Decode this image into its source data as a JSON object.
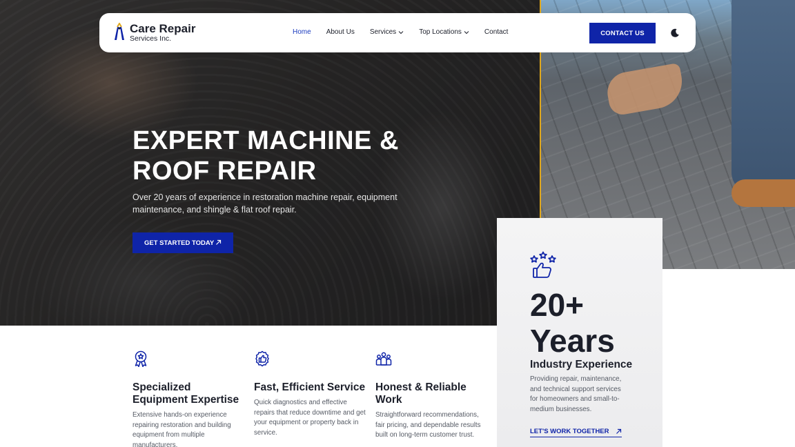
{
  "brand": {
    "title": "Care Repair",
    "subtitle": "Services Inc."
  },
  "nav": {
    "items": [
      {
        "label": "Home",
        "active": true
      },
      {
        "label": "About Us"
      },
      {
        "label": "Services",
        "dropdown": true
      },
      {
        "label": "Top Locations",
        "dropdown": true
      },
      {
        "label": "Contact"
      }
    ],
    "contact_label": "CONTACT US"
  },
  "hero": {
    "title": "EXPERT MACHINE & ROOF REPAIR",
    "subtitle": "Over 20 years of experience in restoration machine repair, equipment maintenance, and shingle & flat roof repair.",
    "cta": "GET STARTED TODAY"
  },
  "stat": {
    "number": "20+",
    "unit": "Years",
    "label": "Industry Experience",
    "description": "Providing repair, maintenance, and technical support services for homeowners and small-to-medium businesses.",
    "link": "LET'S WORK TOGETHER"
  },
  "features": [
    {
      "icon": "award-ribbon-icon",
      "title": "Specialized Equipment Expertise",
      "description": "Extensive hands-on experience repairing restoration and building equipment from multiple manufacturers."
    },
    {
      "icon": "thumbs-up-badge-icon",
      "title": "Fast, Efficient Service",
      "description": "Quick diagnostics and effective repairs that reduce downtime and get your equipment or property back in service."
    },
    {
      "icon": "team-people-icon",
      "title": "Honest & Reliable Work",
      "description": "Straightforward recommendations, fair pricing, and dependable results built on long-term customer trust."
    }
  ],
  "colors": {
    "accent": "#0f24a8",
    "text": "#1c1f2a",
    "muted": "#555a64",
    "divider": "#e0a81c"
  }
}
